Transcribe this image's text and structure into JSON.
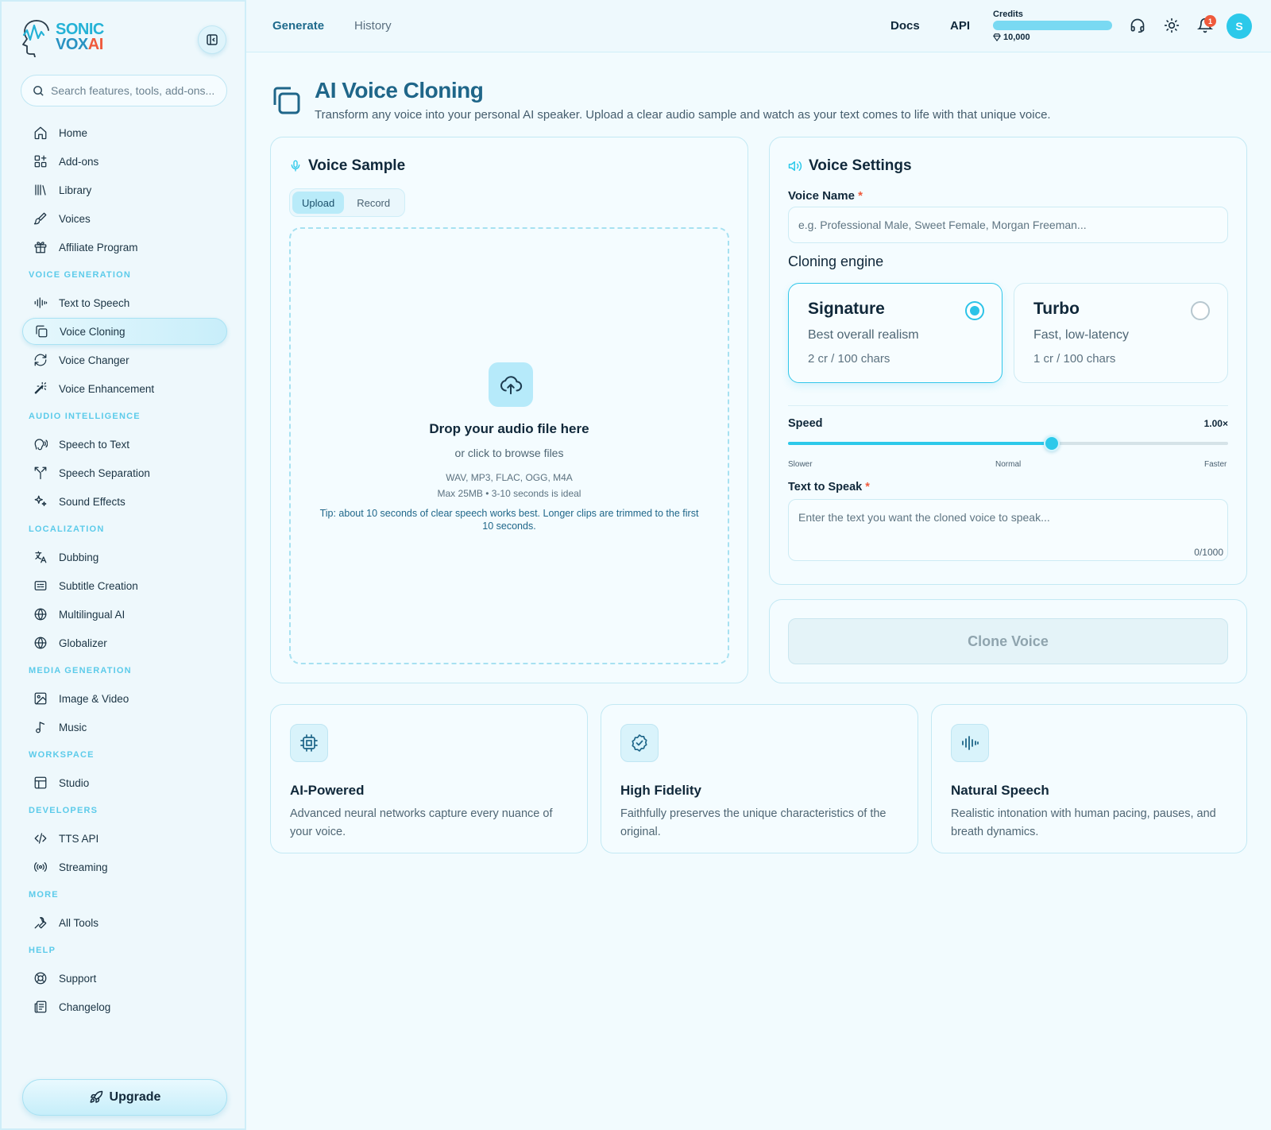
{
  "brand": {
    "line1": "SONIC",
    "line2a": "VOX",
    "line2b": "AI",
    "accent": "#2cc9ea",
    "danger": "#ef5a3c"
  },
  "sidebar": {
    "search_placeholder": "Search features, tools, add-ons...",
    "top_items": [
      {
        "label": "Home",
        "icon": "home-icon"
      },
      {
        "label": "Add-ons",
        "icon": "puzzle-icon"
      },
      {
        "label": "Library",
        "icon": "library-icon"
      },
      {
        "label": "Voices",
        "icon": "brush-icon"
      },
      {
        "label": "Affiliate Program",
        "icon": "gift-icon"
      }
    ],
    "sections": [
      {
        "title": "VOICE GENERATION",
        "items": [
          {
            "label": "Text to Speech",
            "icon": "waveform-icon"
          },
          {
            "label": "Voice Cloning",
            "icon": "copy-icon"
          },
          {
            "label": "Voice Changer",
            "icon": "refresh-icon"
          },
          {
            "label": "Voice Enhancement",
            "icon": "magic-wand-icon"
          }
        ]
      },
      {
        "title": "AUDIO INTELLIGENCE",
        "items": [
          {
            "label": "Speech to Text",
            "icon": "speech-icon"
          },
          {
            "label": "Speech Separation",
            "icon": "split-icon"
          },
          {
            "label": "Sound Effects",
            "icon": "sparkles-icon"
          }
        ]
      },
      {
        "title": "LOCALIZATION",
        "items": [
          {
            "label": "Dubbing",
            "icon": "translate-icon"
          },
          {
            "label": "Subtitle Creation",
            "icon": "subtitles-icon"
          },
          {
            "label": "Multilingual AI",
            "icon": "globe-icon"
          },
          {
            "label": "Globalizer",
            "icon": "globe-icon"
          }
        ]
      },
      {
        "title": "MEDIA GENERATION",
        "items": [
          {
            "label": "Image & Video",
            "icon": "image-icon"
          },
          {
            "label": "Music",
            "icon": "music-icon"
          }
        ]
      },
      {
        "title": "WORKSPACE",
        "items": [
          {
            "label": "Studio",
            "icon": "layout-icon"
          }
        ]
      },
      {
        "title": "DEVELOPERS",
        "items": [
          {
            "label": "TTS API",
            "icon": "code-icon"
          },
          {
            "label": "Streaming",
            "icon": "broadcast-icon"
          }
        ]
      },
      {
        "title": "MORE",
        "items": [
          {
            "label": "All Tools",
            "icon": "wrench-icon"
          }
        ]
      },
      {
        "title": "HELP",
        "items": [
          {
            "label": "Support",
            "icon": "lifebuoy-icon"
          },
          {
            "label": "Changelog",
            "icon": "newspaper-icon"
          }
        ]
      }
    ],
    "upgrade_label": "Upgrade"
  },
  "topbar": {
    "tabs": [
      {
        "label": "Generate"
      },
      {
        "label": "History"
      }
    ],
    "links": [
      {
        "label": "Docs"
      },
      {
        "label": "API"
      }
    ],
    "credits_label": "Credits",
    "credits_value": "10,000",
    "credits_fraction": 1.0,
    "notification_count": "1",
    "avatar_initial": "S"
  },
  "page": {
    "title": "AI Voice Cloning",
    "subtitle": "Transform any voice into your personal AI speaker. Upload a clear audio sample and watch as your text comes to life with that unique voice."
  },
  "voice_sample": {
    "title": "Voice Sample",
    "modes": [
      {
        "label": "Upload"
      },
      {
        "label": "Record"
      }
    ],
    "drop_title": "Drop your audio file here",
    "drop_sub": "or click to browse files",
    "formats": "WAV, MP3, FLAC, OGG, M4A",
    "limits": "Max 25MB • 3-10 seconds is ideal",
    "tip": "Tip: about 10 seconds of clear speech works best. Longer clips are trimmed to the first 10 seconds."
  },
  "voice_settings": {
    "title": "Voice Settings",
    "voice_name_label": "Voice Name",
    "voice_name_placeholder": "e.g. Professional Male, Sweet Female, Morgan Freeman...",
    "required_mark": "*",
    "engine_label": "Cloning engine",
    "engines": [
      {
        "name": "Signature",
        "desc": "Best overall realism",
        "price": "2 cr / 100 chars",
        "selected": true
      },
      {
        "name": "Turbo",
        "desc": "Fast, low-latency",
        "price": "1 cr / 100 chars",
        "selected": false
      }
    ],
    "speed_label": "Speed",
    "speed_value_text": "1.00×",
    "speed_fraction": 0.6,
    "speed_ticks": [
      "Slower",
      "Normal",
      "Faster"
    ],
    "text_label": "Text to Speak",
    "text_placeholder": "Enter the text you want the cloned voice to speak...",
    "char_count": "0/1000",
    "clone_button": "Clone Voice"
  },
  "features": [
    {
      "title": "AI-Powered",
      "desc": "Advanced neural networks capture every nuance of your voice.",
      "icon": "cpu-icon"
    },
    {
      "title": "High Fidelity",
      "desc": "Faithfully preserves the unique characteristics of the original.",
      "icon": "badge-check-icon"
    },
    {
      "title": "Natural Speech",
      "desc": "Realistic intonation with human pacing, pauses, and breath dynamics.",
      "icon": "waveform-icon"
    }
  ]
}
